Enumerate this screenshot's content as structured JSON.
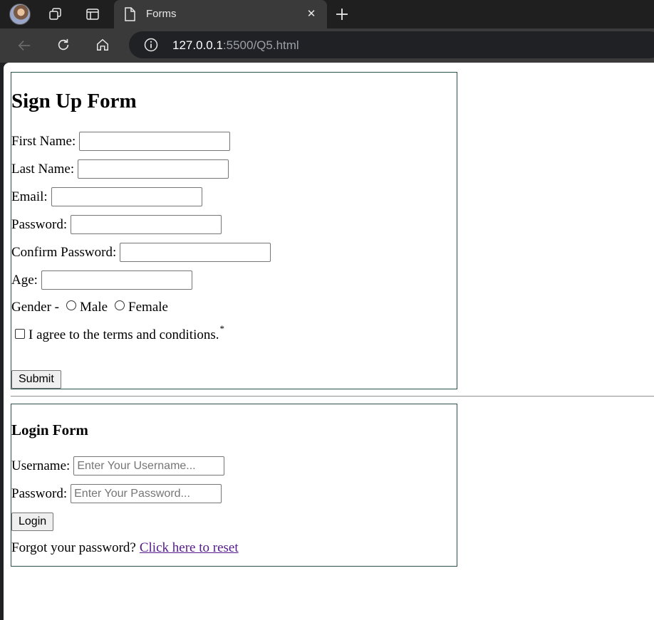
{
  "browser": {
    "tab_title": "Forms",
    "url_host": "127.0.0.1",
    "url_rest": ":5500/Q5.html",
    "icons": [
      "avatar",
      "workspaces-icon",
      "tab-actions-icon",
      "page-icon",
      "close-icon",
      "new-tab-icon",
      "back-icon",
      "reload-icon",
      "home-icon",
      "site-info-icon"
    ]
  },
  "signup": {
    "title": "Sign Up Form",
    "first_name_label": "First Name:",
    "first_name_value": "",
    "last_name_label": "Last Name:",
    "last_name_value": "",
    "email_label": "Email:",
    "email_value": "",
    "password_label": "Password:",
    "password_value": "",
    "confirm_password_label": "Confirm Password:",
    "confirm_password_value": "",
    "age_label": "Age:",
    "age_value": "",
    "gender_label": "Gender -",
    "gender_options": [
      "Male",
      "Female"
    ],
    "terms_label": "I agree to the terms and conditions.",
    "terms_marker": "*",
    "submit_label": "Submit"
  },
  "login": {
    "title": "Login Form",
    "username_label": "Username:",
    "username_placeholder": "Enter Your Username...",
    "password_label": "Password:",
    "password_placeholder": "Enter Your Password...",
    "login_label": "Login",
    "forgot_text": "Forgot your password?",
    "reset_link": "Click here to reset"
  }
}
